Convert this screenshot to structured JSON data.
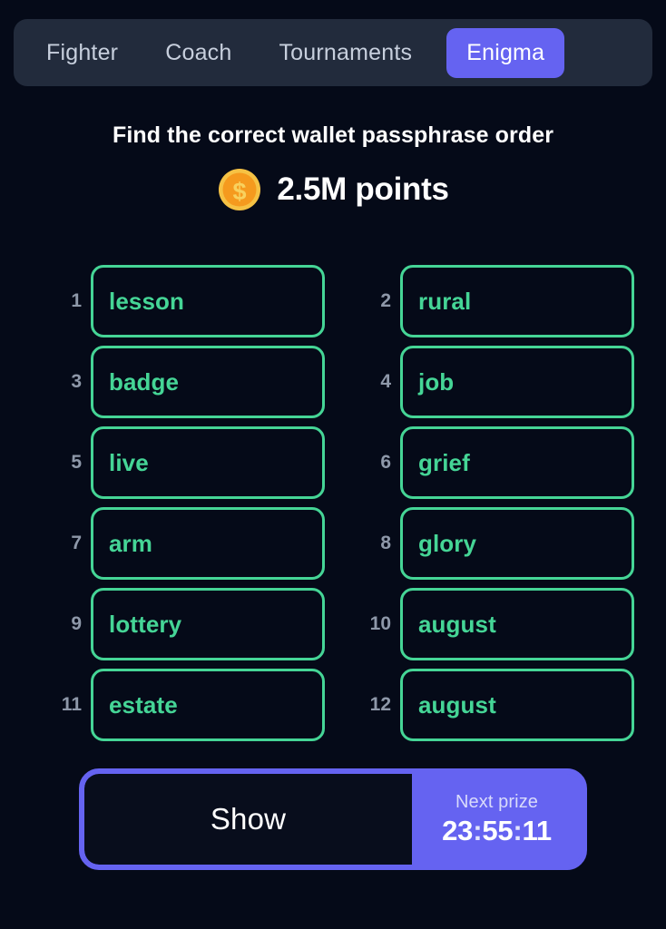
{
  "nav": {
    "items": [
      {
        "label": "Fighter",
        "active": false
      },
      {
        "label": "Coach",
        "active": false
      },
      {
        "label": "Tournaments",
        "active": false
      },
      {
        "label": "Enigma",
        "active": true
      }
    ]
  },
  "header": {
    "title": "Find the correct wallet passphrase order",
    "points": "2.5M points",
    "coin_icon": "gold-coin-dollar-icon"
  },
  "passphrase": {
    "columns": 2,
    "entries": [
      {
        "index": "1",
        "word": "lesson"
      },
      {
        "index": "2",
        "word": "rural"
      },
      {
        "index": "3",
        "word": "badge"
      },
      {
        "index": "4",
        "word": "job"
      },
      {
        "index": "5",
        "word": "live"
      },
      {
        "index": "6",
        "word": "grief"
      },
      {
        "index": "7",
        "word": "arm"
      },
      {
        "index": "8",
        "word": "glory"
      },
      {
        "index": "9",
        "word": "lottery"
      },
      {
        "index": "10",
        "word": "august"
      },
      {
        "index": "11",
        "word": "estate"
      },
      {
        "index": "12",
        "word": "august"
      }
    ]
  },
  "footer": {
    "show_label": "Show",
    "prize_label": "Next prize",
    "timer": {
      "hours": "23",
      "minutes": "55",
      "seconds": "11",
      "separator": ":"
    }
  },
  "colors": {
    "background": "#050a18",
    "navbar": "#222b3c",
    "accent_purple": "#6563f1",
    "word_green": "#45d596",
    "number_gray": "#8e98a9",
    "coin_gold": "#f5a623",
    "text_white": "#ffffff"
  }
}
